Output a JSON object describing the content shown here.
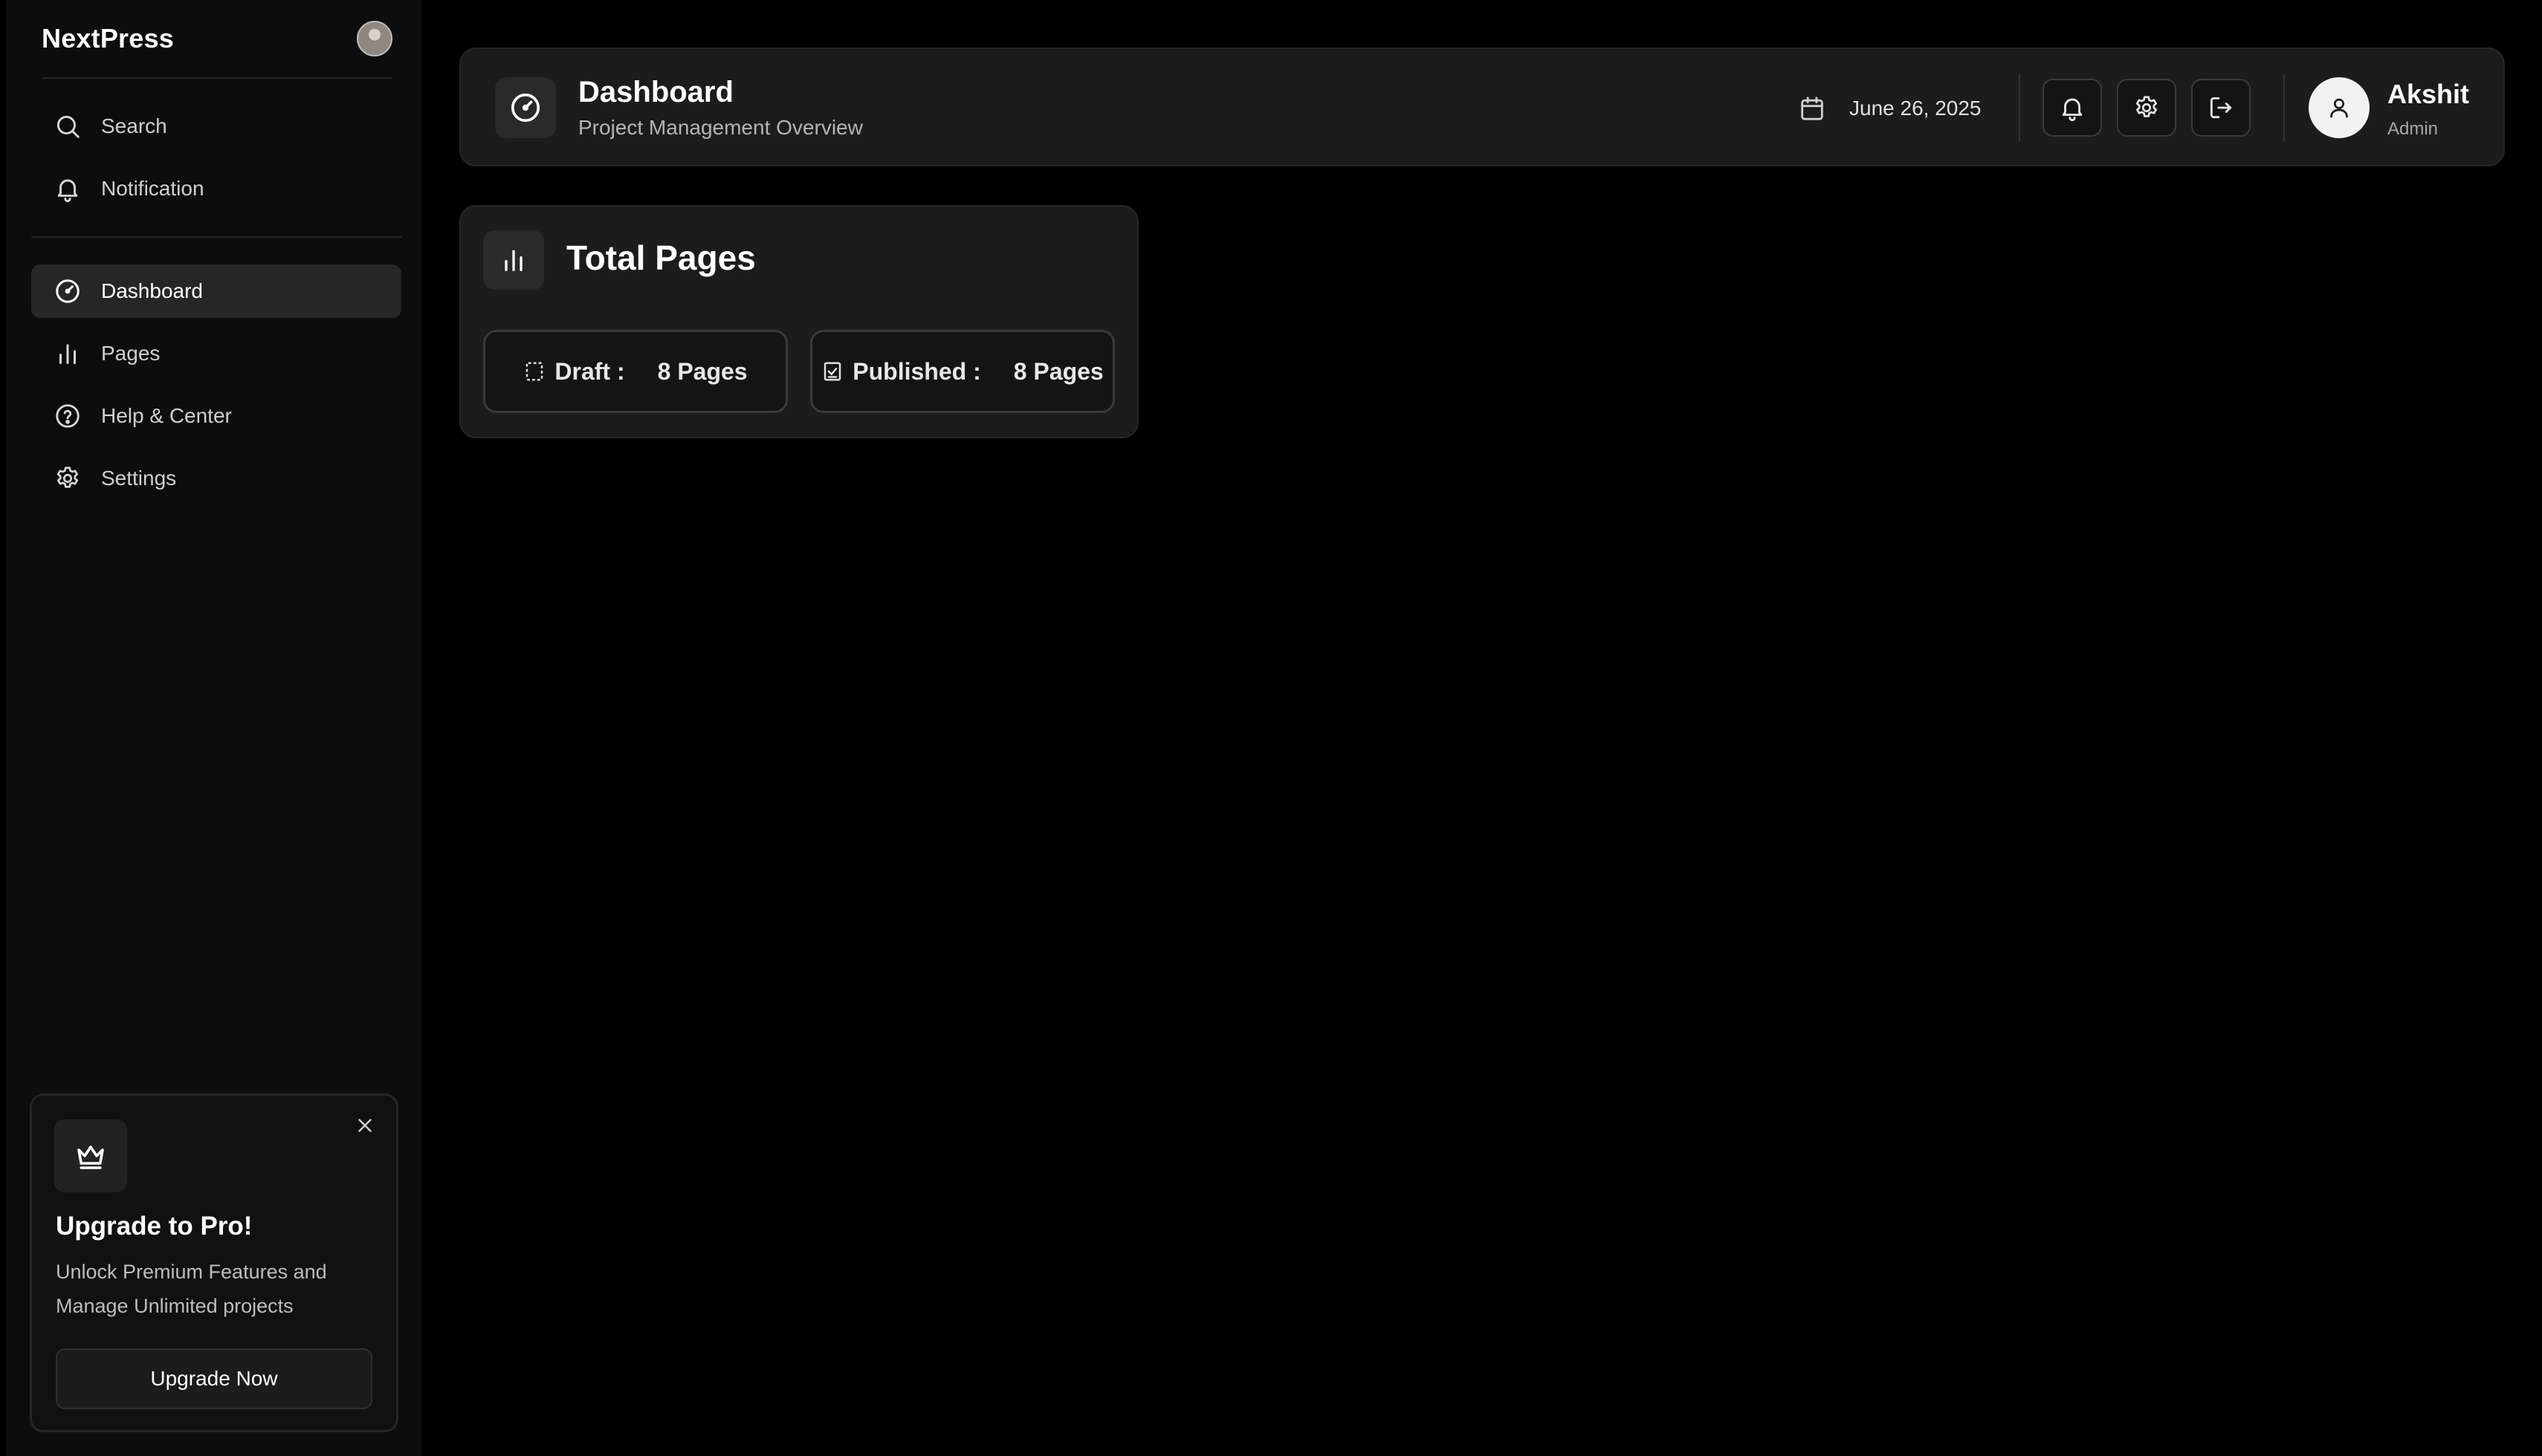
{
  "app": {
    "name": "NextPress"
  },
  "sidebar": {
    "top_items": [
      {
        "label": "Search",
        "icon": "search-icon"
      },
      {
        "label": "Notification",
        "icon": "bell-icon"
      }
    ],
    "nav_items": [
      {
        "label": "Dashboard",
        "icon": "gauge-icon",
        "active": true
      },
      {
        "label": "Pages",
        "icon": "bar-chart-icon",
        "active": false
      },
      {
        "label": "Help & Center",
        "icon": "help-circle-icon",
        "active": false
      },
      {
        "label": "Settings",
        "icon": "gear-icon",
        "active": false
      }
    ],
    "upgrade": {
      "title": "Upgrade to Pro!",
      "description": "Unlock Premium Features and Manage Unlimited projects",
      "button_label": "Upgrade Now",
      "icon": "crown-icon"
    }
  },
  "header": {
    "title": "Dashboard",
    "subtitle": "Project Management Overview",
    "date": "June 26, 2025",
    "user": {
      "name": "Akshit",
      "role": "Admin"
    }
  },
  "total_pages": {
    "title": "Total Pages",
    "draft": {
      "label": "Draft :",
      "value": "8 Pages"
    },
    "published": {
      "label": "Published :",
      "value": "8 Pages"
    }
  },
  "colors": {
    "background": "#000000",
    "sidebar": "#0d0d0d",
    "card": "#1c1c1c",
    "active_item": "#262626",
    "text_primary": "#ffffff",
    "text_muted": "#b5b5b5"
  }
}
